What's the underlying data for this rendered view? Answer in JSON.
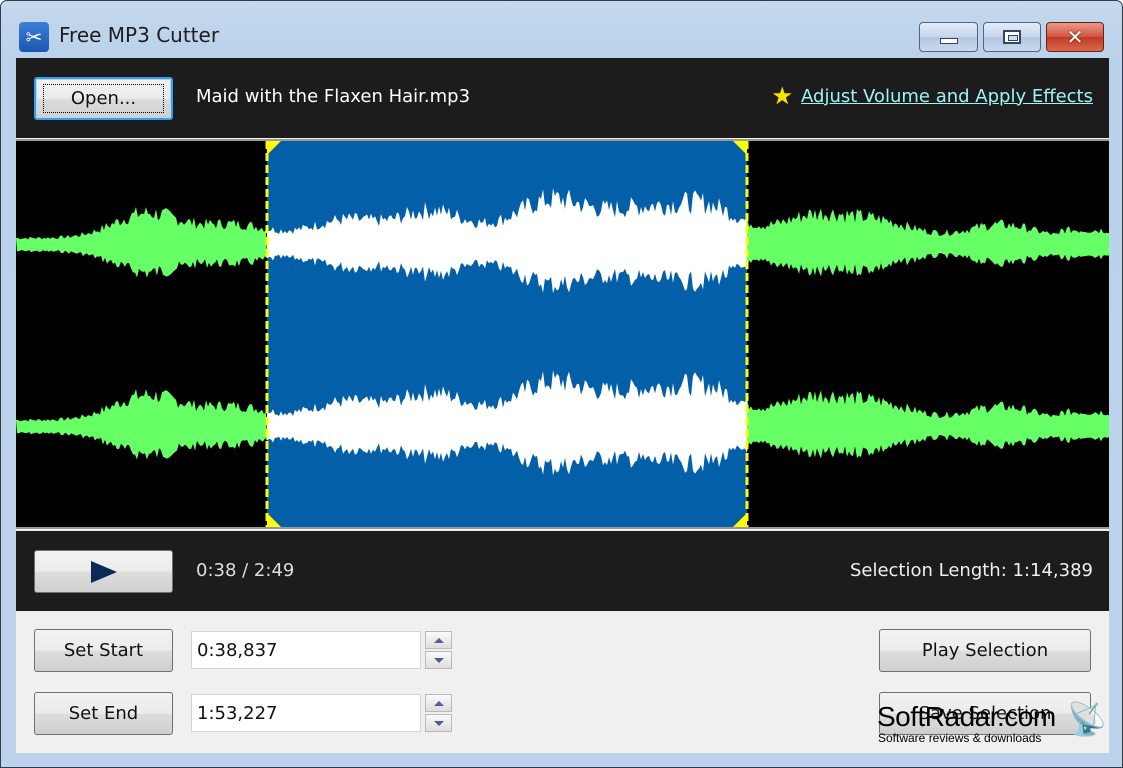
{
  "window": {
    "title": "Free MP3 Cutter",
    "app_icon": "scissors-icon",
    "controls": {
      "minimize": "minimize-icon",
      "maximize": "maximize-icon",
      "close": "close-icon"
    }
  },
  "toolbar": {
    "open_label": "Open...",
    "file_name": "Maid with the Flaxen Hair.mp3",
    "effects_icon": "star-icon",
    "effects_link": "Adjust Volume and Apply Effects"
  },
  "waveform": {
    "channels": 2,
    "selection_start_fraction": 0.2296,
    "selection_end_fraction": 0.6692,
    "colors": {
      "background": "#000000",
      "wave": "#66ff66",
      "selection_bg": "#035fa8",
      "selection_wave": "#ffffff",
      "marker": "#ffff00"
    }
  },
  "transport": {
    "play_icon": "play-icon",
    "time_readout": "0:38 / 2:49",
    "selection_length": "Selection Length: 1:14,389"
  },
  "range": {
    "set_start_label": "Set Start",
    "set_end_label": "Set End",
    "start_value": "0:38,837",
    "end_value": "1:53,227"
  },
  "actions": {
    "play_selection_label": "Play Selection",
    "save_selection_label": "Save Selection"
  },
  "watermark": {
    "title": "SoftRadar.com",
    "subtitle": "Software reviews & downloads"
  }
}
